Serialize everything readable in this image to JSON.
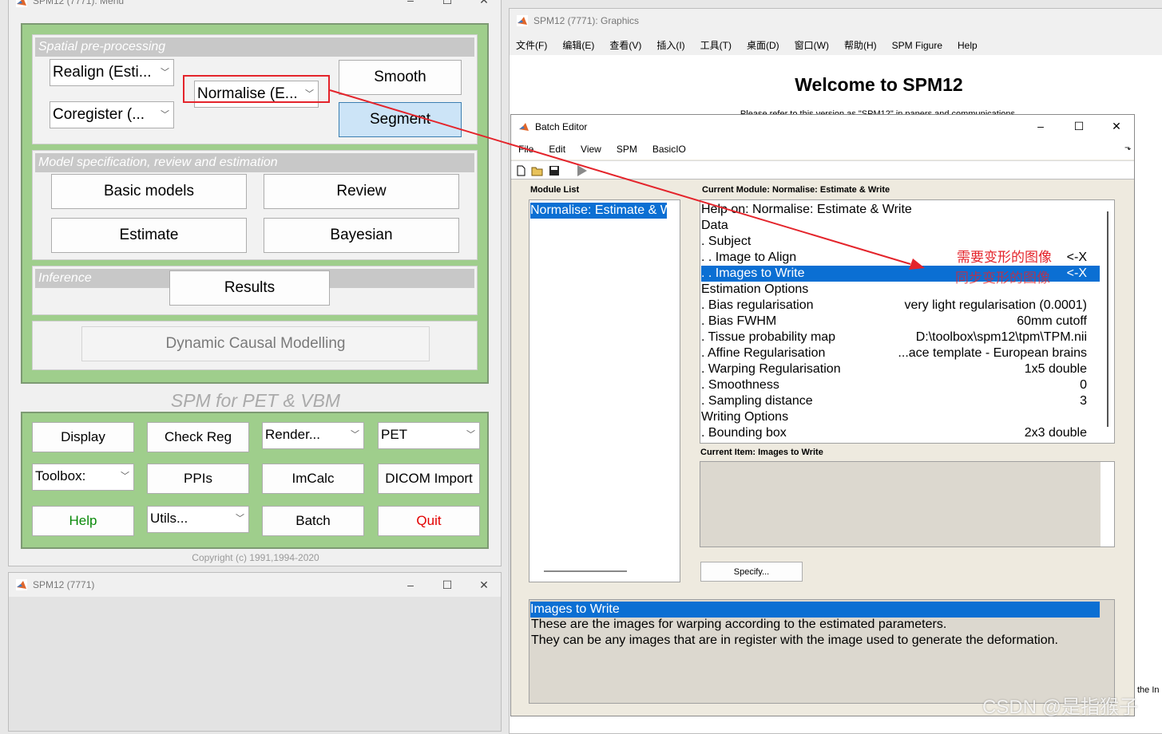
{
  "menu_window": {
    "title": "SPM12 (7771): Menu",
    "sections": {
      "spatial": {
        "header": "Spatial pre-processing",
        "realign": "Realign (Esti...",
        "coregister": "Coregister (...",
        "normalise": "Normalise (E...",
        "smooth": "Smooth",
        "segment": "Segment"
      },
      "model": {
        "header": "Model specification, review and estimation",
        "basic_models": "Basic models",
        "review": "Review",
        "estimate": "Estimate",
        "bayesian": "Bayesian"
      },
      "inference": {
        "header": "Inference",
        "results": "Results"
      },
      "dcm": "Dynamic Causal Modelling"
    },
    "modality_label": "SPM for PET & VBM",
    "buttons": {
      "display": "Display",
      "check_reg": "Check Reg",
      "render": "Render...",
      "modality": "PET",
      "toolbox": "Toolbox:",
      "ppis": "PPIs",
      "imcalc": "ImCalc",
      "dicom_import": "DICOM Import",
      "help": "Help",
      "utils": "Utils...",
      "batch": "Batch",
      "quit": "Quit"
    },
    "copyright": "Copyright (c) 1991,1994-2020",
    "colors": {
      "panel": "#9fce8c",
      "help": "#0a8a0a",
      "quit": "#e30000"
    }
  },
  "small_window": {
    "title": "SPM12 (7771)"
  },
  "graphics_window": {
    "title": "SPM12 (7771): Graphics",
    "menus": [
      "文件(F)",
      "编辑(E)",
      "查看(V)",
      "插入(I)",
      "工具(T)",
      "桌面(D)",
      "窗口(W)",
      "帮助(H)",
      "SPM Figure",
      "Help"
    ],
    "welcome": "Welcome to SPM12",
    "subtitle": "Please refer to this version as \"SPM12\" in papers and communications."
  },
  "batch_editor": {
    "title": "Batch Editor",
    "menus": [
      "File",
      "Edit",
      "View",
      "SPM",
      "BasicIO"
    ],
    "module_list_label": "Module List",
    "module_item": "Normalise: Estimate & Write",
    "current_module_label": "Current Module: Normalise: Estimate & Write",
    "rows": [
      {
        "label": "Help on: Normalise: Estimate & Write",
        "value": ""
      },
      {
        "label": "Data",
        "value": ""
      },
      {
        "label": " . Subject",
        "value": ""
      },
      {
        "label": " . . Image to Align",
        "value": "<-X"
      },
      {
        "label": " . . Images to Write",
        "value": "<-X"
      },
      {
        "label": "Estimation Options",
        "value": ""
      },
      {
        "label": " . Bias regularisation",
        "value": "very light regularisation (0.0001)"
      },
      {
        "label": " . Bias FWHM",
        "value": "60mm cutoff"
      },
      {
        "label": " . Tissue probability map",
        "value": "D:\\toolbox\\spm12\\tpm\\TPM.nii"
      },
      {
        "label": " . Affine Regularisation",
        "value": "...ace template - European brains"
      },
      {
        "label": " . Warping Regularisation",
        "value": "1x5 double"
      },
      {
        "label": " . Smoothness",
        "value": "0"
      },
      {
        "label": " . Sampling distance",
        "value": "3"
      },
      {
        "label": "Writing Options",
        "value": ""
      },
      {
        "label": " . Bounding box",
        "value": "2x3 double"
      }
    ],
    "annotation_1": "需要变形的图像",
    "annotation_2": "同步变形的图像",
    "current_item_label": "Current Item: Images to Write",
    "specify_button": "Specify...",
    "help_title": "Images to Write",
    "help_line_1": "These are the images for warping according to the estimated parameters.",
    "help_line_2": "They can be any images that are in register with the image used to generate the deformation.",
    "annotation_color": "#e4242b"
  },
  "edge_text": "the In",
  "watermark": "CSDN @是指猴子"
}
